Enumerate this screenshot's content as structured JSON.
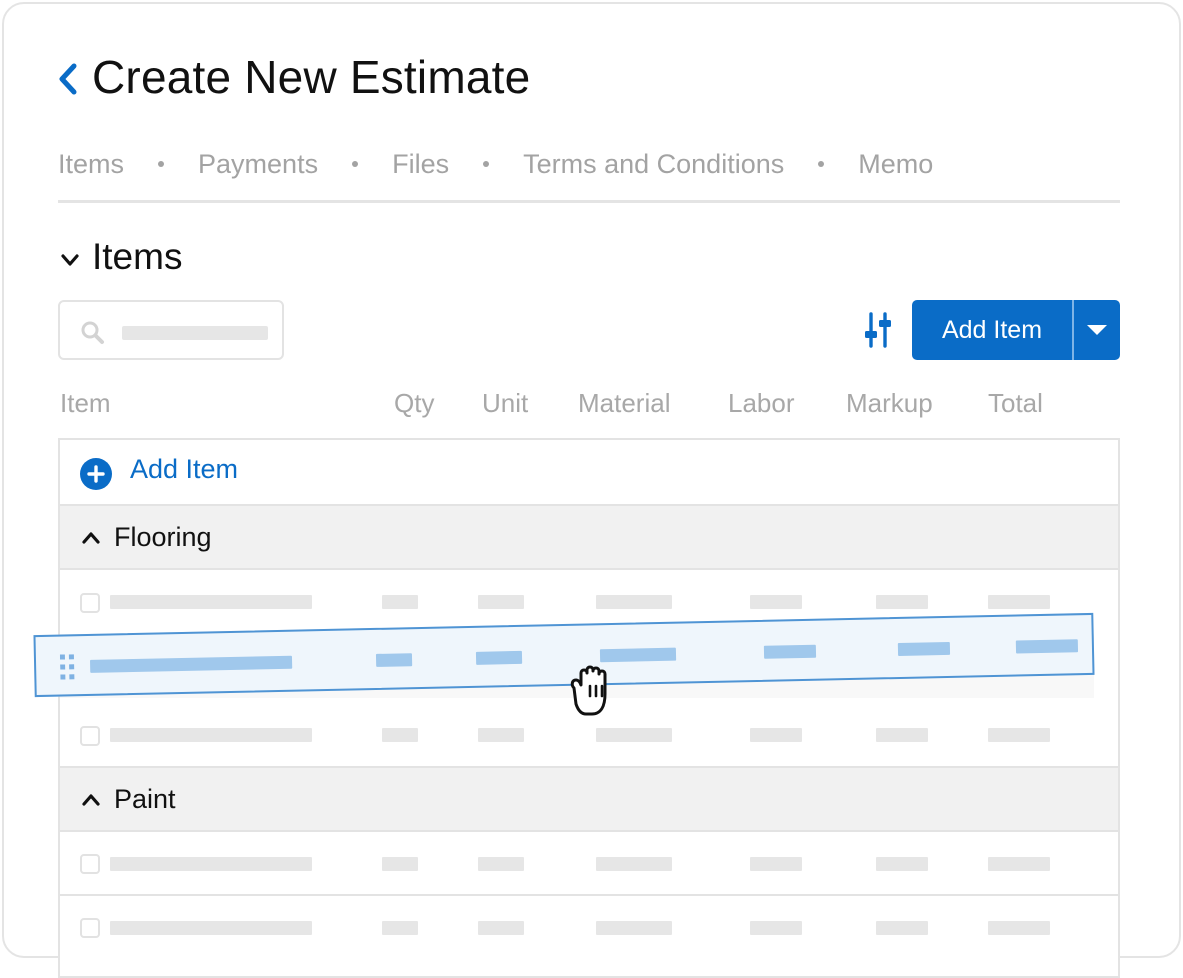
{
  "page": {
    "title": "Create New Estimate"
  },
  "tabs": [
    "Items",
    "Payments",
    "Files",
    "Terms and Conditions",
    "Memo"
  ],
  "section": {
    "title": "Items"
  },
  "toolbar": {
    "add_item_label": "Add Item"
  },
  "columns": [
    "Item",
    "Qty",
    "Unit",
    "Material",
    "Labor",
    "Markup",
    "Total"
  ],
  "table": {
    "add_item_label": "Add Item",
    "groups": [
      {
        "name": "Flooring"
      },
      {
        "name": "Paint"
      }
    ]
  },
  "colors": {
    "accent": "#0a6cc7",
    "drag_border": "#4f94d4",
    "drag_fill": "#eff6fc",
    "placeholder": "#e6e6e6",
    "muted_text": "#a3a3a3"
  },
  "icons": [
    "back-chevron-icon",
    "chevron-down-icon",
    "search-icon",
    "filter-sliders-icon",
    "caret-down-icon",
    "plus-circle-icon",
    "chevron-up-icon",
    "drag-grip-icon",
    "grab-hand-cursor-icon"
  ]
}
